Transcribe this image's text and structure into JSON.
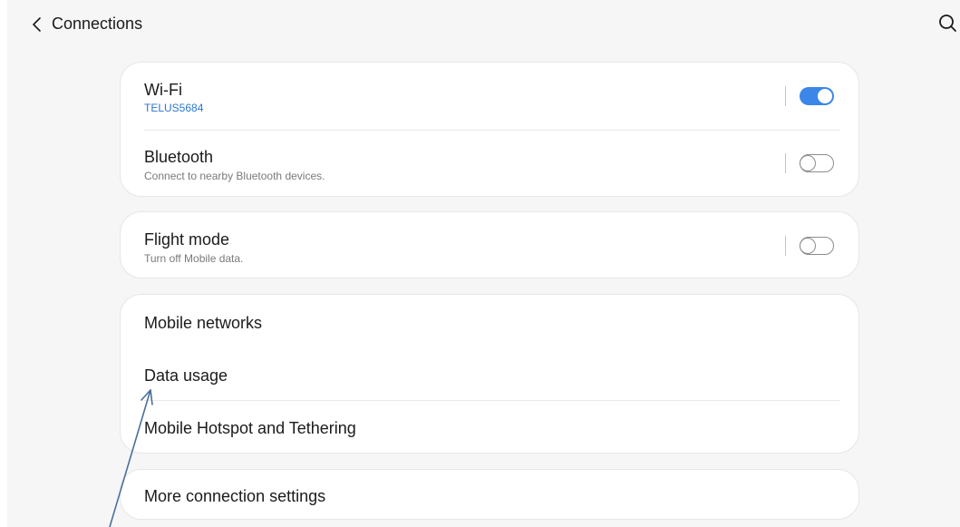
{
  "header": {
    "title": "Connections",
    "back_icon": "chevron-left-icon",
    "search_icon": "search-icon"
  },
  "groups": [
    {
      "rows": [
        {
          "title": "Wi-Fi",
          "subtitle": "TELUS5684",
          "toggle": "on"
        },
        {
          "title": "Bluetooth",
          "subtitle": "Connect to nearby Bluetooth devices.",
          "toggle": "off"
        }
      ]
    },
    {
      "rows": [
        {
          "title": "Flight mode",
          "subtitle": "Turn off Mobile data.",
          "toggle": "off"
        }
      ]
    },
    {
      "rows": [
        {
          "title": "Mobile networks"
        },
        {
          "title": "Data usage"
        },
        {
          "title": "Mobile Hotspot and Tethering"
        }
      ]
    },
    {
      "rows": [
        {
          "title": "More connection settings"
        }
      ]
    }
  ],
  "colors": {
    "accent": "#3b86e8",
    "subtitle_accent": "#2a77d0",
    "background": "#f6f6f6",
    "card": "#ffffff",
    "annotation_arrow": "#4a6f9c"
  }
}
